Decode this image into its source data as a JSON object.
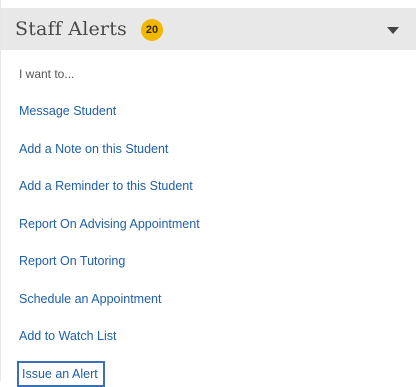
{
  "header": {
    "title": "Staff Alerts",
    "badge_count": "20",
    "toggle_icon": "chevron-down-icon"
  },
  "menu": {
    "prompt": "I want to...",
    "items": [
      {
        "label": "Message Student"
      },
      {
        "label": "Add a Note on this Student"
      },
      {
        "label": "Add a Reminder to this Student"
      },
      {
        "label": "Report On Advising Appointment"
      },
      {
        "label": "Report On Tutoring"
      },
      {
        "label": "Schedule an Appointment"
      },
      {
        "label": "Add to Watch List"
      },
      {
        "label": "Issue an Alert",
        "selected": true
      }
    ]
  },
  "colors": {
    "header_bg": "#e8e8e8",
    "badge": "#f2b800",
    "link": "#1f5fa8",
    "focus_border": "#3b6fb8"
  }
}
